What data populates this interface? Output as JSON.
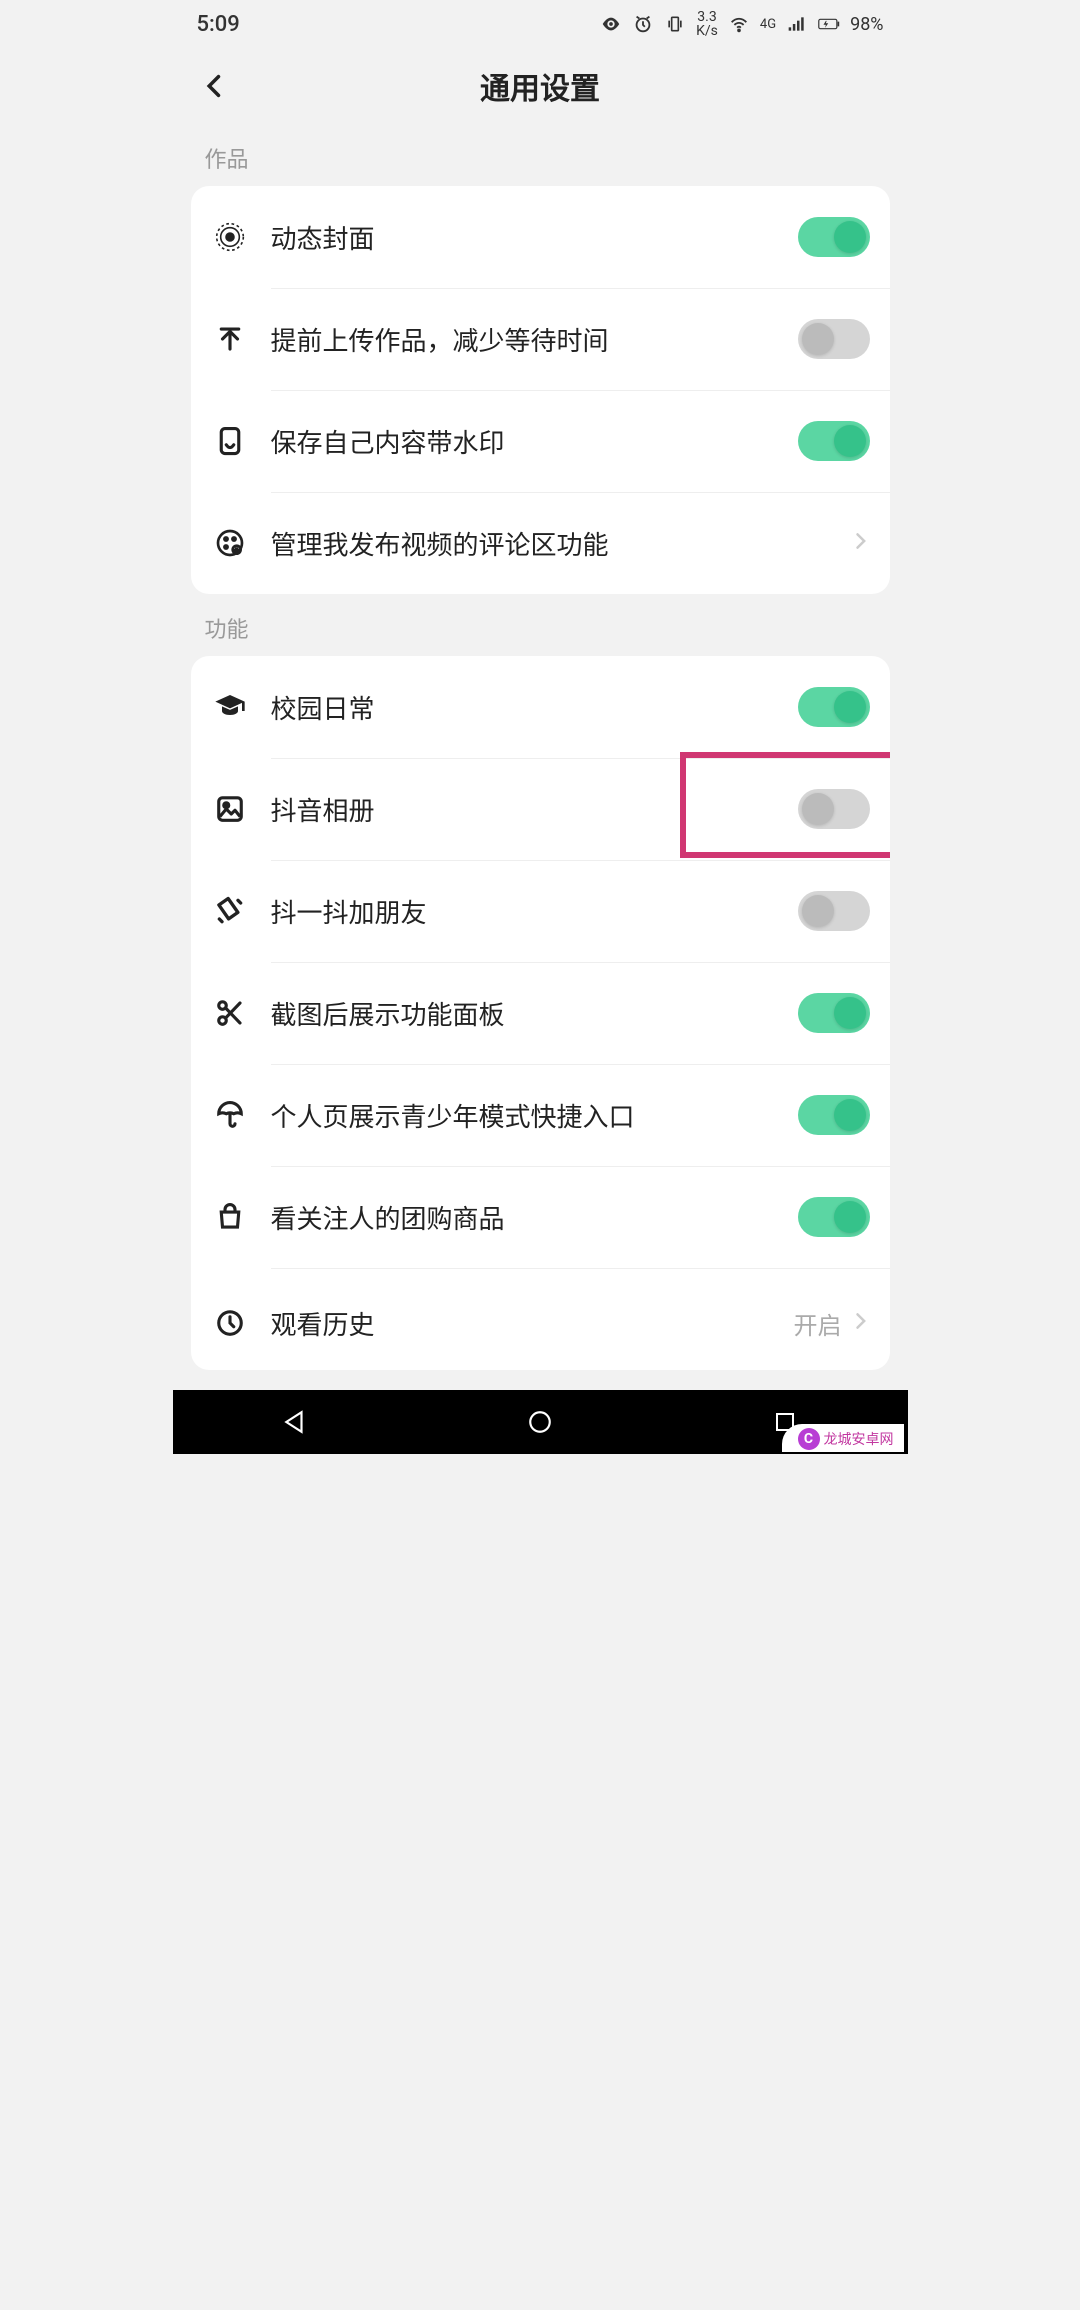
{
  "status_bar": {
    "time": "5:09",
    "speed_top": "3.3",
    "speed_bottom": "K/s",
    "net": "4G",
    "battery": "98%"
  },
  "header": {
    "title": "通用设置"
  },
  "sections": {
    "works": {
      "label": "作品",
      "items": [
        {
          "label": "动态封面",
          "toggle": true
        },
        {
          "label": "提前上传作品，减少等待时间",
          "toggle": false
        },
        {
          "label": "保存自己内容带水印",
          "toggle": true
        },
        {
          "label": "管理我发布视频的评论区功能",
          "nav": true
        }
      ]
    },
    "features": {
      "label": "功能",
      "items": [
        {
          "label": "校园日常",
          "toggle": true
        },
        {
          "label": "抖音相册",
          "toggle": false,
          "highlighted": true
        },
        {
          "label": "抖一抖加朋友",
          "toggle": false
        },
        {
          "label": "截图后展示功能面板",
          "toggle": true
        },
        {
          "label": "个人页展示青少年模式快捷入口",
          "toggle": true
        },
        {
          "label": "看关注人的团购商品",
          "toggle": true
        },
        {
          "label": "观看历史",
          "value": "开启",
          "nav": true
        }
      ]
    }
  },
  "watermark": {
    "text": "龙城安卓网"
  }
}
